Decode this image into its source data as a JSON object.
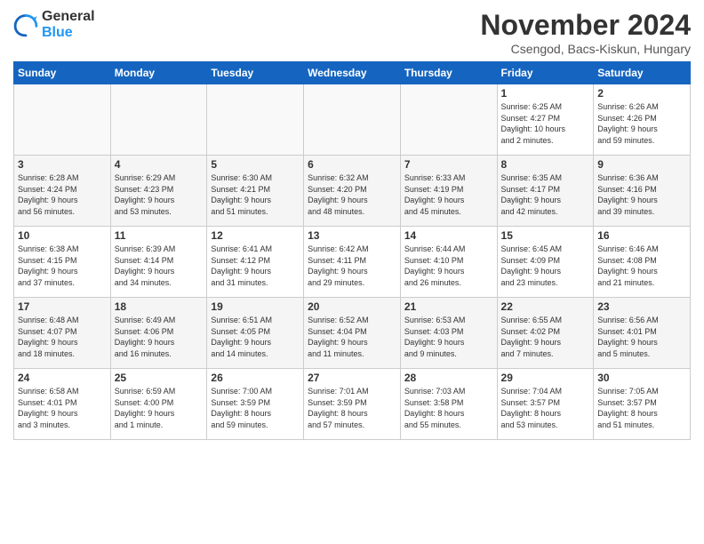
{
  "logo": {
    "line1": "General",
    "line2": "Blue"
  },
  "title": "November 2024",
  "subtitle": "Csengod, Bacs-Kiskun, Hungary",
  "days": [
    "Sunday",
    "Monday",
    "Tuesday",
    "Wednesday",
    "Thursday",
    "Friday",
    "Saturday"
  ],
  "weeks": [
    [
      {
        "day": "",
        "info": ""
      },
      {
        "day": "",
        "info": ""
      },
      {
        "day": "",
        "info": ""
      },
      {
        "day": "",
        "info": ""
      },
      {
        "day": "",
        "info": ""
      },
      {
        "day": "1",
        "info": "Sunrise: 6:25 AM\nSunset: 4:27 PM\nDaylight: 10 hours\nand 2 minutes."
      },
      {
        "day": "2",
        "info": "Sunrise: 6:26 AM\nSunset: 4:26 PM\nDaylight: 9 hours\nand 59 minutes."
      }
    ],
    [
      {
        "day": "3",
        "info": "Sunrise: 6:28 AM\nSunset: 4:24 PM\nDaylight: 9 hours\nand 56 minutes."
      },
      {
        "day": "4",
        "info": "Sunrise: 6:29 AM\nSunset: 4:23 PM\nDaylight: 9 hours\nand 53 minutes."
      },
      {
        "day": "5",
        "info": "Sunrise: 6:30 AM\nSunset: 4:21 PM\nDaylight: 9 hours\nand 51 minutes."
      },
      {
        "day": "6",
        "info": "Sunrise: 6:32 AM\nSunset: 4:20 PM\nDaylight: 9 hours\nand 48 minutes."
      },
      {
        "day": "7",
        "info": "Sunrise: 6:33 AM\nSunset: 4:19 PM\nDaylight: 9 hours\nand 45 minutes."
      },
      {
        "day": "8",
        "info": "Sunrise: 6:35 AM\nSunset: 4:17 PM\nDaylight: 9 hours\nand 42 minutes."
      },
      {
        "day": "9",
        "info": "Sunrise: 6:36 AM\nSunset: 4:16 PM\nDaylight: 9 hours\nand 39 minutes."
      }
    ],
    [
      {
        "day": "10",
        "info": "Sunrise: 6:38 AM\nSunset: 4:15 PM\nDaylight: 9 hours\nand 37 minutes."
      },
      {
        "day": "11",
        "info": "Sunrise: 6:39 AM\nSunset: 4:14 PM\nDaylight: 9 hours\nand 34 minutes."
      },
      {
        "day": "12",
        "info": "Sunrise: 6:41 AM\nSunset: 4:12 PM\nDaylight: 9 hours\nand 31 minutes."
      },
      {
        "day": "13",
        "info": "Sunrise: 6:42 AM\nSunset: 4:11 PM\nDaylight: 9 hours\nand 29 minutes."
      },
      {
        "day": "14",
        "info": "Sunrise: 6:44 AM\nSunset: 4:10 PM\nDaylight: 9 hours\nand 26 minutes."
      },
      {
        "day": "15",
        "info": "Sunrise: 6:45 AM\nSunset: 4:09 PM\nDaylight: 9 hours\nand 23 minutes."
      },
      {
        "day": "16",
        "info": "Sunrise: 6:46 AM\nSunset: 4:08 PM\nDaylight: 9 hours\nand 21 minutes."
      }
    ],
    [
      {
        "day": "17",
        "info": "Sunrise: 6:48 AM\nSunset: 4:07 PM\nDaylight: 9 hours\nand 18 minutes."
      },
      {
        "day": "18",
        "info": "Sunrise: 6:49 AM\nSunset: 4:06 PM\nDaylight: 9 hours\nand 16 minutes."
      },
      {
        "day": "19",
        "info": "Sunrise: 6:51 AM\nSunset: 4:05 PM\nDaylight: 9 hours\nand 14 minutes."
      },
      {
        "day": "20",
        "info": "Sunrise: 6:52 AM\nSunset: 4:04 PM\nDaylight: 9 hours\nand 11 minutes."
      },
      {
        "day": "21",
        "info": "Sunrise: 6:53 AM\nSunset: 4:03 PM\nDaylight: 9 hours\nand 9 minutes."
      },
      {
        "day": "22",
        "info": "Sunrise: 6:55 AM\nSunset: 4:02 PM\nDaylight: 9 hours\nand 7 minutes."
      },
      {
        "day": "23",
        "info": "Sunrise: 6:56 AM\nSunset: 4:01 PM\nDaylight: 9 hours\nand 5 minutes."
      }
    ],
    [
      {
        "day": "24",
        "info": "Sunrise: 6:58 AM\nSunset: 4:01 PM\nDaylight: 9 hours\nand 3 minutes."
      },
      {
        "day": "25",
        "info": "Sunrise: 6:59 AM\nSunset: 4:00 PM\nDaylight: 9 hours\nand 1 minute."
      },
      {
        "day": "26",
        "info": "Sunrise: 7:00 AM\nSunset: 3:59 PM\nDaylight: 8 hours\nand 59 minutes."
      },
      {
        "day": "27",
        "info": "Sunrise: 7:01 AM\nSunset: 3:59 PM\nDaylight: 8 hours\nand 57 minutes."
      },
      {
        "day": "28",
        "info": "Sunrise: 7:03 AM\nSunset: 3:58 PM\nDaylight: 8 hours\nand 55 minutes."
      },
      {
        "day": "29",
        "info": "Sunrise: 7:04 AM\nSunset: 3:57 PM\nDaylight: 8 hours\nand 53 minutes."
      },
      {
        "day": "30",
        "info": "Sunrise: 7:05 AM\nSunset: 3:57 PM\nDaylight: 8 hours\nand 51 minutes."
      }
    ]
  ]
}
